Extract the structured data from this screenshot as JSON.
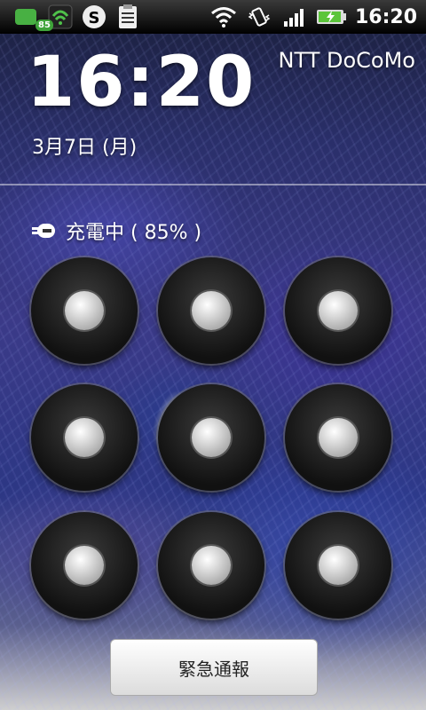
{
  "status_bar": {
    "notification_badge": "85",
    "time": "16:20",
    "icons": [
      "notification-icon",
      "shield-icon",
      "skype-icon",
      "clipboard-icon",
      "wifi-icon",
      "vibrate-icon",
      "signal-icon",
      "battery-charging-icon"
    ]
  },
  "lock": {
    "clock": "16:20",
    "carrier": "NTT DoCoMo",
    "date": "3月7日 (月)",
    "charging_text": "充電中 ( 85% )"
  },
  "pattern": {
    "dots": 9
  },
  "emergency_button": {
    "label": "緊急通報"
  },
  "colors": {
    "status_bar_bg": "#000000",
    "text": "#ffffff",
    "badge_green": "#3fa33a"
  }
}
